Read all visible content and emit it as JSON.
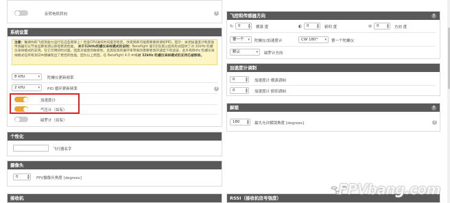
{
  "top": {
    "reverse_motor_label": "反转电机转向"
  },
  "system_config": {
    "title": "系统设置",
    "note_prefix": "注意：",
    "note_text": "确保你的飞控有能力运行在这些频率上！检查CPU通讯时间是否稳定。改变频率可能需要重新调校PID。提示：关闭加速度计和其他传感器可以节省运算资源以获得更高性能。",
    "note_bold": "关于32kHz陀螺仪采样模式的说明：",
    "note_text2": "Betaflight 第3次及其以后的形式提供了对 32kHz 陀螺仪采样模式的支持。在它可用的时间里，因其对噪音的敏感性，且其较高的循环率带来的需要更高的速度下的滤波，此外有8kHz 陀螺仪采样模式在所有测试中都展现出了更佳的性能。因为以上原因，在 Betaflight 4.0 中将",
    "note_bold2": "对 32kHz 陀螺仪采样模式的支持已被移除。",
    "gyro_freq_value": "8 kHz",
    "gyro_freq_label": "陀螺仪更新频率",
    "pid_freq_value": "2 kHz",
    "pid_freq_label": "PID 循环更新频率",
    "accel_label": "加速度计",
    "baro_label": "气压计（如有）",
    "mag_label": "磁罗计（如有）"
  },
  "personalization": {
    "title": "个性化",
    "craft_name_label": "飞行器名字",
    "craft_name_value": ""
  },
  "camera": {
    "title": "摄像头",
    "fpv_angle_value": "0",
    "fpv_angle_label": "FPV摄像头角度 [degrees]"
  },
  "receiver": {
    "title": "接收机"
  },
  "board_alignment": {
    "title": "飞控和传感器方向",
    "roll_value": "0",
    "roll_label": "横滚 度",
    "pitch_value": "0",
    "pitch_label": "俯仰 度",
    "yaw_value": "0",
    "yaw_label": "方向 度",
    "first_gyro_value": "第一个",
    "first_gyro_label": "陀螺仪/加速度计",
    "cw_value": "CW 180°",
    "cw_label": "第一个陀螺仪",
    "mag_default_value": "默认",
    "mag_align_label": "磁罗计方向"
  },
  "accel_trim": {
    "title": "加速度计调制",
    "roll_trim_value": "0",
    "roll_trim_label": "加速度计 横滚调制",
    "pitch_trim_value": "0",
    "pitch_trim_label": "加速度计 俯仰调制"
  },
  "arming": {
    "title": "解锁",
    "max_angle_value": "180",
    "max_angle_label": "最大允许解锁角度 [degrees]"
  },
  "rssi": {
    "title": "RSSI（接收机信号强度）"
  },
  "watermark": {
    "text": "FPVbang.com"
  }
}
